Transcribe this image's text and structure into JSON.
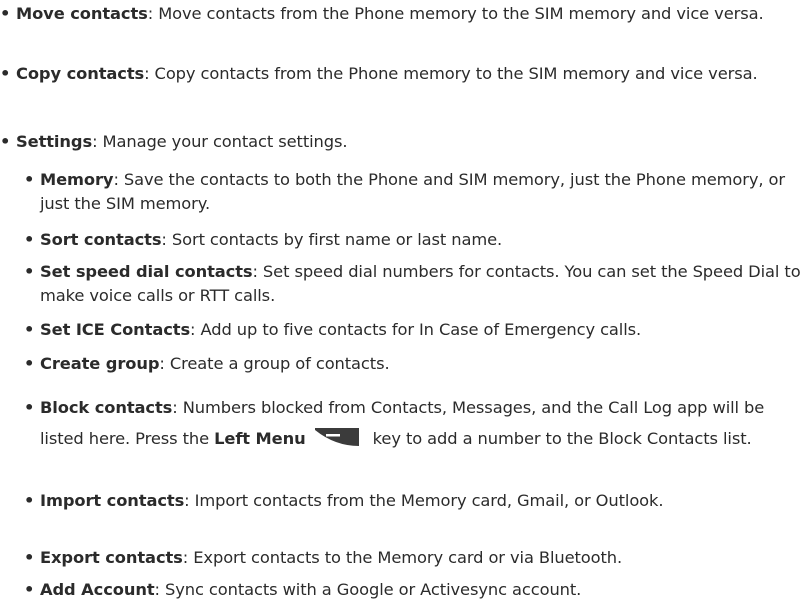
{
  "items": [
    {
      "term": "Move contacts",
      "desc": ": Move contacts from the Phone memory to the SIM memory and vice versa."
    },
    {
      "term": "Copy contacts",
      "desc": ": Copy contacts from the Phone memory to the SIM memory and vice versa."
    },
    {
      "term": "Settings",
      "desc": ": Manage your contact settings."
    }
  ],
  "sub_items": [
    {
      "term": "Memory",
      "desc": ": Save the contacts to both the Phone and SIM memory, just the Phone memory, or just the SIM memory."
    },
    {
      "term": "Sort contacts",
      "desc": ": Sort contacts by first name or last name."
    },
    {
      "term": "Set speed dial contacts",
      "desc": ": Set speed dial numbers for contacts. You can set the Speed Dial to make voice calls or RTT calls."
    },
    {
      "term": "Set ICE Contacts",
      "desc": ": Add up to five contacts for In Case of Emergency calls."
    },
    {
      "term": "Create group",
      "desc": ": Create a group of contacts."
    },
    {
      "term": "Block contacts",
      "desc": ": Numbers blocked from Contacts, Messages, and the Call Log app will be listed here. Press the ",
      "key_term": "Left Menu",
      "key_icon": "left-menu-key-icon",
      "desc_after": " key to add a number to the Block Contacts list."
    },
    {
      "term": "Import contacts",
      "desc": ": Import contacts from the Memory card, Gmail, or Outlook."
    },
    {
      "term": "Export contacts",
      "desc": ": Export contacts to the Memory card or via Bluetooth."
    },
    {
      "term": "Add Account",
      "desc": ": Sync contacts with a Google or Activesync account."
    }
  ],
  "bullet_char": "•",
  "colors": {
    "text": "#2b2b2b",
    "key_icon": "#3b3b3b",
    "background": "#ffffff"
  }
}
